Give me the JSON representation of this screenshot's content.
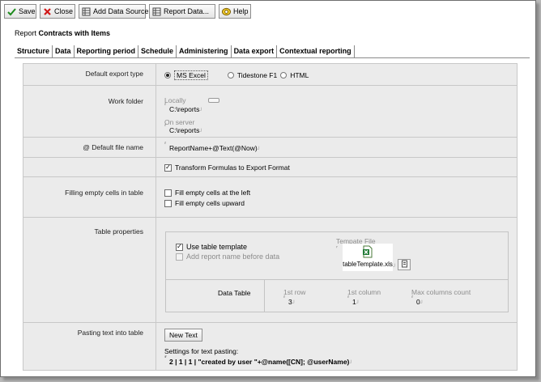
{
  "toolbar": {
    "save": {
      "label": "Save",
      "icon": "check-icon"
    },
    "close": {
      "label": "Close",
      "icon": "close-icon"
    },
    "add_data_source": {
      "label": "Add Data Source",
      "icon": "data-source-icon"
    },
    "report_data": {
      "label": "Report Data...",
      "icon": "report-data-icon"
    },
    "help": {
      "label": "Help",
      "icon": "help-icon"
    }
  },
  "report": {
    "prefix": "Report",
    "name": "Contracts with Items"
  },
  "tabs": [
    {
      "label": "Structure"
    },
    {
      "label": "Data"
    },
    {
      "label": "Reporting period"
    },
    {
      "label": "Schedule"
    },
    {
      "label": "Administering"
    },
    {
      "label": "Data export",
      "active": true
    },
    {
      "label": "Contextual reporting"
    }
  ],
  "export_type": {
    "label": "Default export type",
    "options": [
      {
        "label": "MS Excel",
        "selected": true
      },
      {
        "label": "Tidestone F1",
        "selected": false
      },
      {
        "label": "HTML",
        "selected": false
      }
    ]
  },
  "work_folder": {
    "label": "Work folder",
    "locally_label": "Locally",
    "locally_value": "C:\\reports",
    "server_label": "On server",
    "server_value": "C:\\reports"
  },
  "file_name": {
    "label": "@ Default file name",
    "value": "ReportName+@Text(@Now)"
  },
  "transform": {
    "label": "Transform Formulas to Export Format",
    "checked": true
  },
  "filling": {
    "label": "Filling empty cells in table",
    "left": {
      "label": "Fill empty cells at the left",
      "checked": false
    },
    "upward": {
      "label": "Fill empty cells upward",
      "checked": false
    }
  },
  "table_props": {
    "label": "Table properties",
    "use_template": {
      "label": "Use table template",
      "checked": true
    },
    "add_name": {
      "label": "Add report name before data",
      "checked": false
    },
    "template_file_label": "Tempate File",
    "template_file_name": "tableTemplate.xls",
    "data_table_label": "Data Table",
    "first_row_label": "1st row",
    "first_row_value": "3",
    "first_col_label": "1st column",
    "first_col_value": "1",
    "max_cols_label": "Max columns count",
    "max_cols_value": "0"
  },
  "pasting": {
    "label": "Pasting text into table",
    "new_text_button": "New Text",
    "settings_label": "Settings for text pasting:",
    "settings_value": "2 | 1 | 1 | \"created by user \"+@name([CN]; @userName)"
  }
}
